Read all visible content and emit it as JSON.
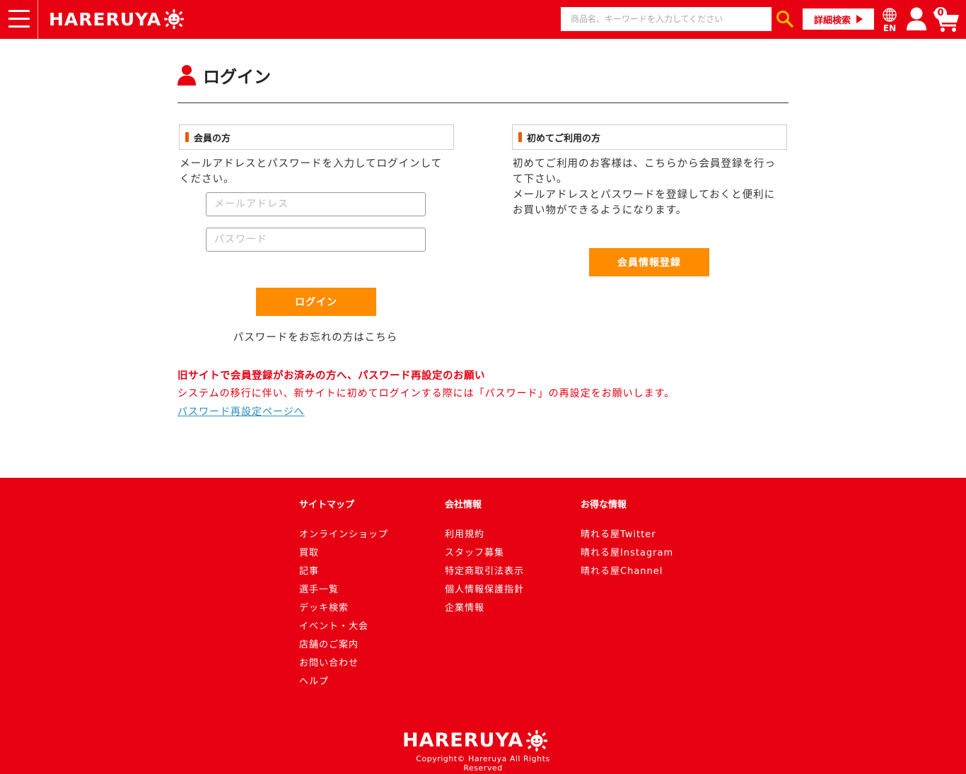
{
  "header": {
    "logo_text": "HARERUYA",
    "search_placeholder": "商品名、キーワードを入力してください",
    "advanced_search_label": "詳細検索",
    "language_label": "EN",
    "cart_count": "0"
  },
  "main": {
    "page_title": "ログイン",
    "member": {
      "heading": "会員の方",
      "description_line1": "メールアドレスとパスワードを入力してログインして",
      "description_line2": "ください。",
      "email_placeholder": "メールアドレス",
      "password_placeholder": "パスワード",
      "login_button": "ログイン",
      "forgot_link": "パスワードをお忘れの方はこちら"
    },
    "new_user": {
      "heading": "初めてご利用の方",
      "description_lines": [
        "初めてご利用のお客様は、こちらから会員登録を行っ",
        "て下さい。",
        "メールアドレスとパスワードを登録しておくと便利に",
        "お買い物ができるようになります。"
      ],
      "register_button": "会員情報登録"
    },
    "notice": {
      "title": "旧サイトで会員登録がお済みの方へ、パスワード再設定のお願い",
      "body": "システムの移行に伴い、新サイトに初めてログインする際には「パスワード」の再設定をお願いします。",
      "link": "パスワード再設定ページへ"
    }
  },
  "footer": {
    "columns": [
      {
        "title": "サイトマップ",
        "items": [
          "オンラインショップ",
          "買取",
          "記事",
          "選手一覧",
          "デッキ検索",
          "イベント・大会",
          "店舗のご案内",
          "お問い合わせ",
          "ヘルプ"
        ]
      },
      {
        "title": "会社情報",
        "items": [
          "利用規約",
          "スタッフ募集",
          "特定商取引法表示",
          "個人情報保護指針",
          "企業情報"
        ]
      },
      {
        "title": "お得な情報",
        "items": [
          "晴れる屋Twitter",
          "晴れる屋Instagram",
          "晴れる屋Channel"
        ]
      }
    ],
    "logo_text": "HARERUYA",
    "copyright": "Copyright© Hareruya All Rights Reserved"
  },
  "colors": {
    "brand_red": "#e60012",
    "button_orange": "#ff8c00",
    "accent_bar": "#e65c00",
    "link_blue": "#2a8fbd"
  }
}
